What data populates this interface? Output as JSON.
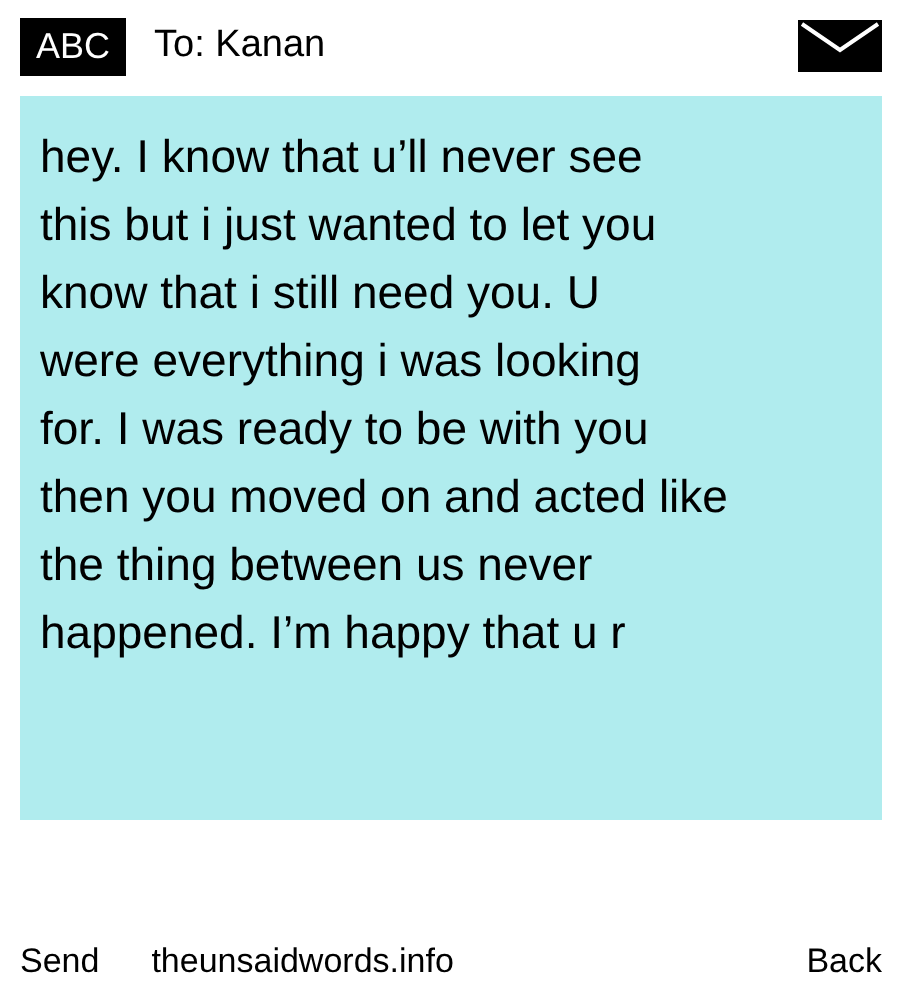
{
  "header": {
    "logo": "ABC",
    "recipient": "To: Kanan"
  },
  "message": {
    "text": "hey. I know that u’ll never see\nthis but i just wanted to let you\nknow that i still need you. U\nwere everything i was looking\nfor. I was ready to be with you\nthen you moved on and acted like\nthe thing between us never\nhappened. I’m happy that u r"
  },
  "footer": {
    "send": "Send",
    "site": "theunsaidwords.info",
    "back": "Back"
  }
}
